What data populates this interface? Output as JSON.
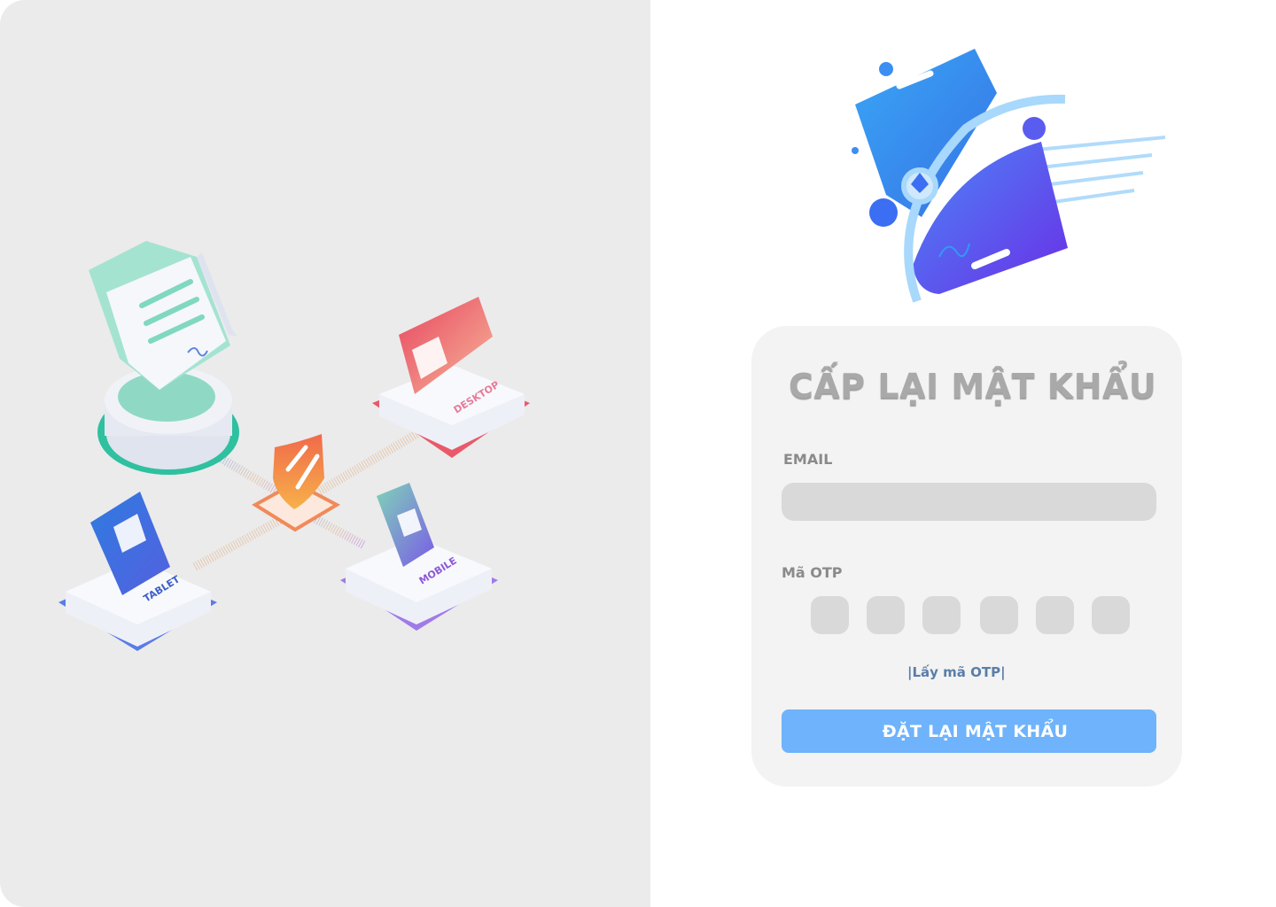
{
  "form": {
    "title": "CẤP LẠI MẬT KHẨU",
    "email_label": "EMAIL",
    "email_value": "",
    "otp_label": "Mã OTP",
    "otp_digits": [
      "",
      "",
      "",
      "",
      "",
      ""
    ],
    "get_otp_link": "|Lấy mã OTP|",
    "submit_label": "ĐẶT LẠI MẬT KHẨU"
  },
  "illustration": {
    "device_labels": {
      "desktop": "DESKTOP",
      "tablet": "TABLET",
      "mobile": "MOBILE"
    }
  },
  "colors": {
    "left_bg": "#ebebeb",
    "card_bg": "#f3f3f3",
    "input_bg": "#d9d9d9",
    "button_bg": "#6eb3fb",
    "link": "#5a7ea8",
    "title": "#a9a9a9"
  },
  "icons": {
    "logo": "signing-devices-logo",
    "hero": "multi-device-signing-illustration"
  }
}
